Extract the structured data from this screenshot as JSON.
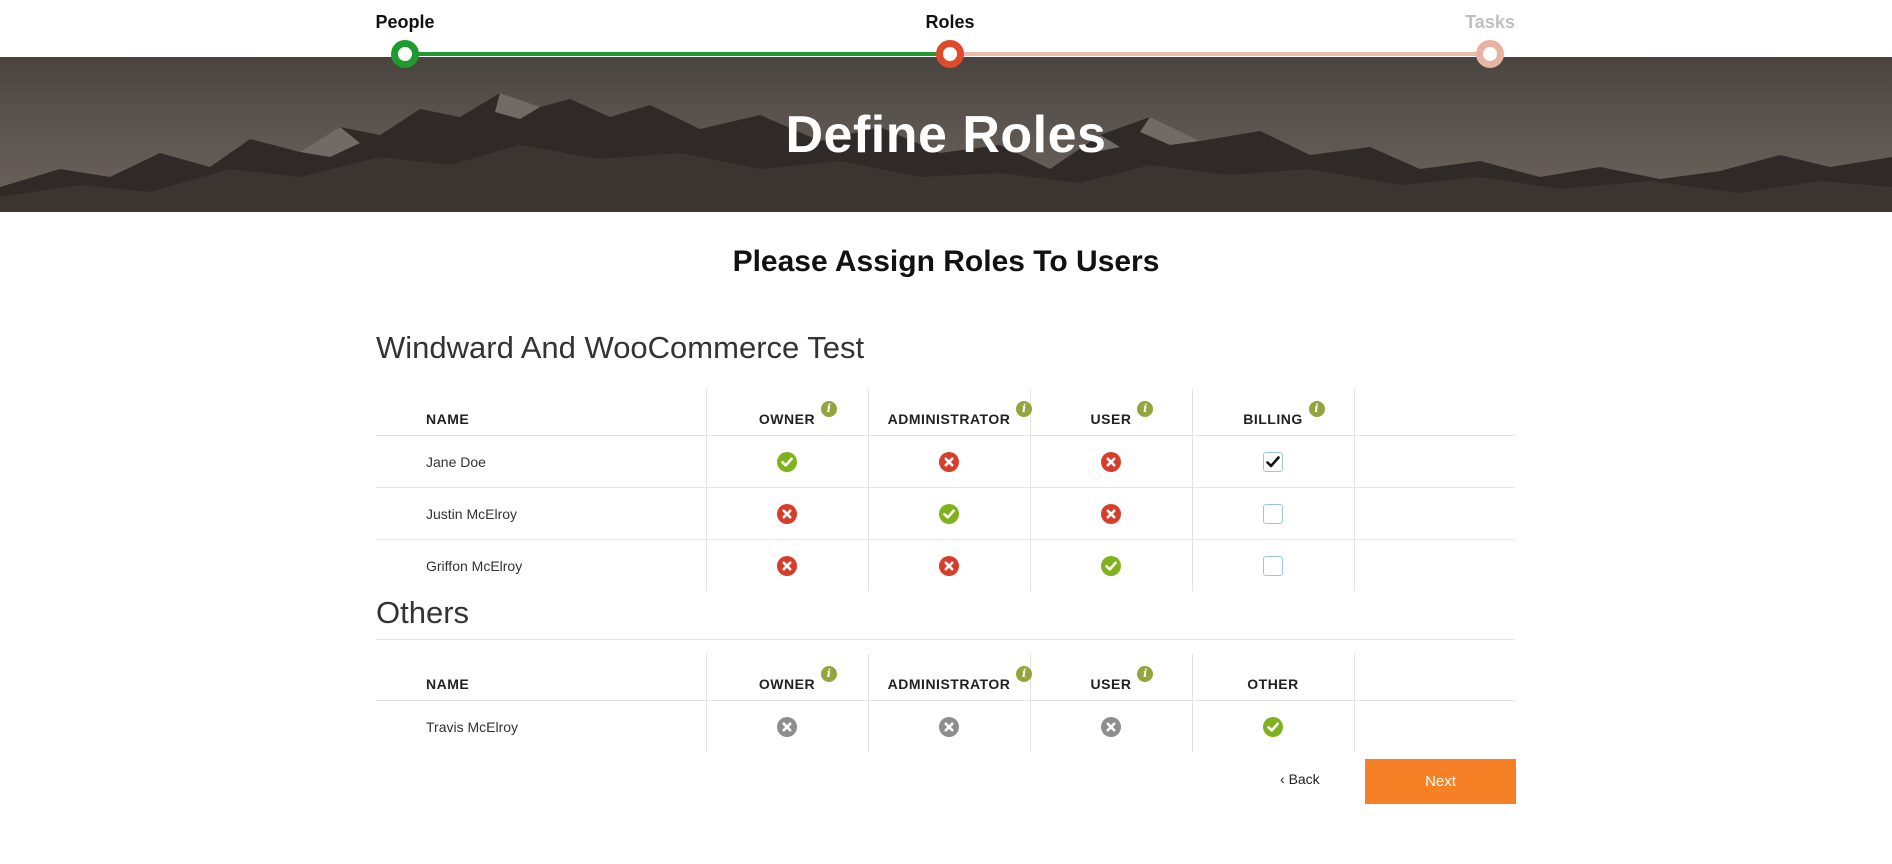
{
  "stepper": {
    "steps": [
      {
        "label": "People",
        "state": "done"
      },
      {
        "label": "Roles",
        "state": "current"
      },
      {
        "label": "Tasks",
        "state": "todo"
      }
    ],
    "colors": {
      "done": "#1f9a2f",
      "current": "#df4a2b",
      "todo": "#e9b3a4"
    }
  },
  "banner": {
    "title": "Define Roles"
  },
  "page": {
    "subtitle": "Please Assign Roles To Users"
  },
  "sections": [
    {
      "title": "Windward And WooCommerce Test",
      "columns": {
        "name": "NAME",
        "owner": "OWNER",
        "administrator": "ADMINISTRATOR",
        "user": "USER",
        "billing": "BILLING"
      },
      "rows": [
        {
          "name": "Jane Doe",
          "owner": "yes",
          "administrator": "no",
          "user": "no",
          "billing": true
        },
        {
          "name": "Justin McElroy",
          "owner": "no",
          "administrator": "yes",
          "user": "no",
          "billing": false
        },
        {
          "name": "Griffon McElroy",
          "owner": "no",
          "administrator": "no",
          "user": "yes",
          "billing": false
        }
      ]
    },
    {
      "title": "Others",
      "columns": {
        "name": "NAME",
        "owner": "OWNER",
        "administrator": "ADMINISTRATOR",
        "user": "USER",
        "other": "OTHER"
      },
      "rows": [
        {
          "name": "Travis McElroy",
          "owner": "gray",
          "administrator": "gray",
          "user": "gray",
          "other": "yes"
        }
      ]
    }
  ],
  "info_icon": {
    "glyph": "i",
    "color": "#93a53e"
  },
  "status_icons": {
    "yes": "check-circle-icon",
    "no": "x-circle-icon",
    "gray": "x-circle-disabled-icon"
  },
  "status_colors": {
    "yes": "#7fb21c",
    "no": "#d63d2a",
    "gray": "#8e8e8e"
  },
  "footer": {
    "back_icon": "‹",
    "back_label": "Back",
    "next_label": "Next",
    "next_color": "#f58025"
  }
}
